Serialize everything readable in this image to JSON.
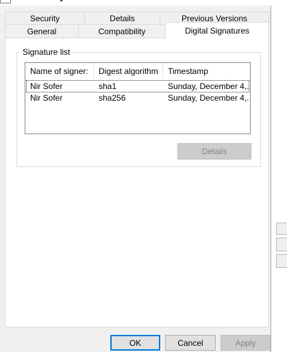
{
  "tabs_back": [
    {
      "label": "Security"
    },
    {
      "label": "Details"
    },
    {
      "label": "Previous Versions"
    }
  ],
  "tabs_front": [
    {
      "label": "General"
    },
    {
      "label": "Compatibility"
    },
    {
      "label": "Digital Signatures",
      "active": true
    }
  ],
  "signature_group": {
    "legend": "Signature list",
    "columns": [
      "Name of signer:",
      "Digest algorithm",
      "Timestamp"
    ],
    "rows": [
      {
        "signer": "Nir Sofer",
        "digest": "sha1",
        "timestamp": "Sunday, December 4,..."
      },
      {
        "signer": "Nir Sofer",
        "digest": "sha256",
        "timestamp": "Sunday, December 4,..."
      }
    ],
    "details_label": "Details"
  },
  "footer": {
    "ok_label": "OK",
    "cancel_label": "Cancel",
    "apply_label": "Apply"
  }
}
